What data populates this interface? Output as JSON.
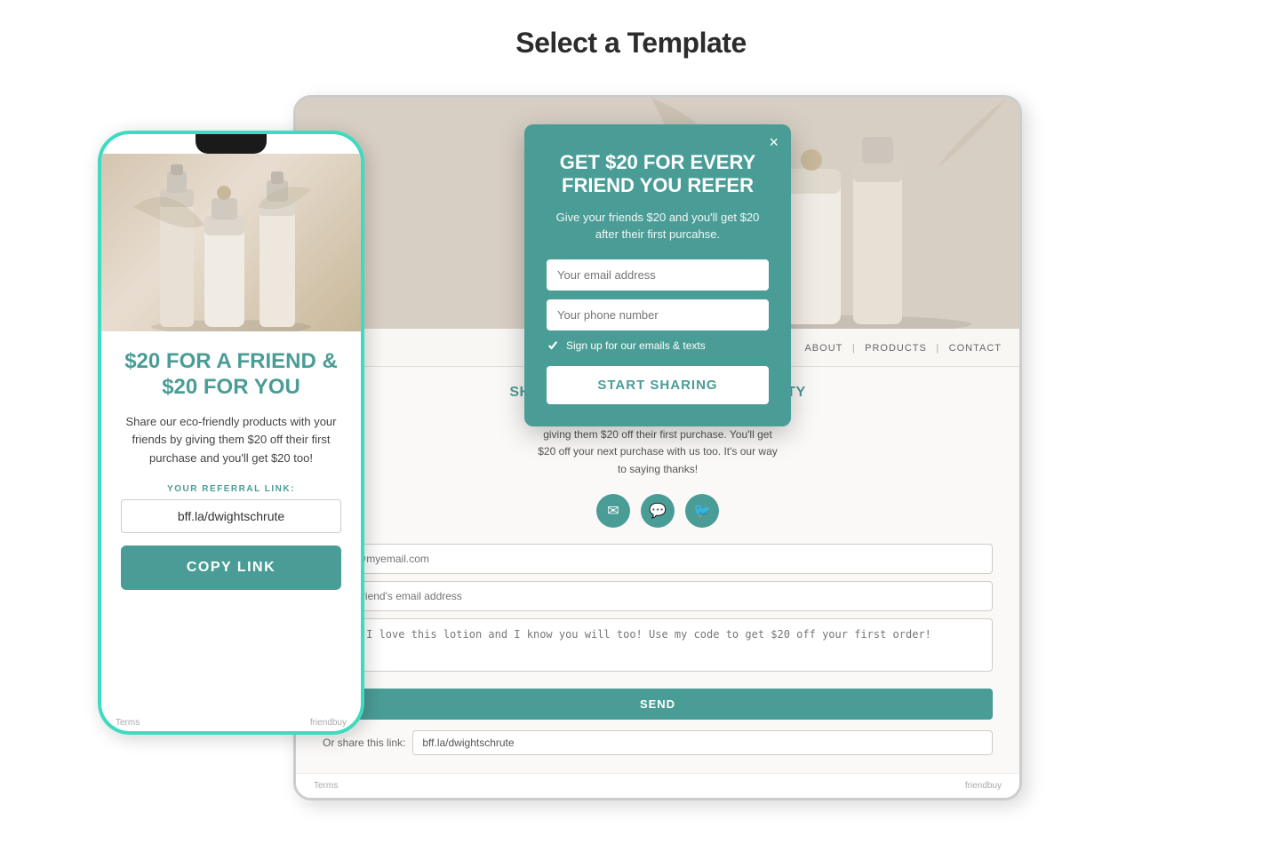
{
  "page": {
    "title": "Select a Template",
    "bg_color": "#f5f5f5"
  },
  "popup": {
    "close_label": "×",
    "title": "GET $20 FOR EVERY FRIEND YOU REFER",
    "subtitle": "Give your friends $20 and you'll get $20 after their first purcahse.",
    "email_placeholder": "Your email address",
    "phone_placeholder": "Your phone number",
    "checkbox_label": "Sign up for our emails & texts",
    "cta_label": "START SHARING"
  },
  "phone": {
    "main_title": "$20 FOR A FRIEND & $20 FOR YOU",
    "description": "Share our eco-friendly products with your friends by giving them $20 off their first purchase and you'll get $20 too!",
    "referral_label": "YOUR REFERRAL LINK:",
    "referral_link": "bff.la/dwightschrute",
    "copy_btn": "COPY LINK",
    "footer_terms": "Terms",
    "footer_brand": "friendbuy"
  },
  "tablet": {
    "nav": {
      "about": "ABOUT",
      "products": "PRODUCTS",
      "contact": "CONTACT",
      "sep1": "|",
      "sep2": "|"
    },
    "share_title": "SHARE THE LOVE OF ORGANIC BEAUTY",
    "share_desc": "Share our eco-friendly products with your friends by giving them $20 off their first purchase. You'll get $20 off your next purchase with us too. It's our way to saying thanks!",
    "icons": [
      "✉",
      "💬",
      "🐦"
    ],
    "form": {
      "email_placeholder": "kelly@myemail.com",
      "friend_email_placeholder": "Your friend's email address",
      "message_value": "Hey! I love this lotion and I know you will too! Use my code to get $20 off your first order!",
      "send_btn": "SEND",
      "share_link_label": "Or share this link:",
      "share_link_value": "bff.la/dwightschrute"
    },
    "footer_terms": "Terms",
    "footer_brand": "friendbuy"
  },
  "colors": {
    "teal": "#4a9d96",
    "teal_bright": "#3ddbc0",
    "dark_text": "#2c2c2c"
  }
}
